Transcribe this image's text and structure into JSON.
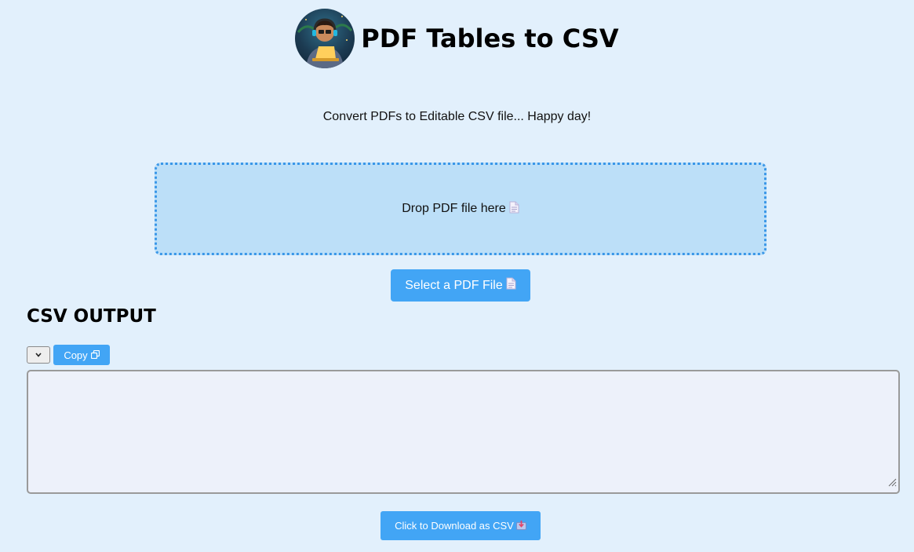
{
  "header": {
    "title": "PDF Tables to CSV",
    "avatar_icon": "coder-avatar-icon"
  },
  "tagline": "Convert PDFs to Editable CSV file... Happy day!",
  "dropzone": {
    "label": "Drop PDF file here",
    "icon": "document-icon"
  },
  "select_button": {
    "label": "Select a PDF File",
    "icon": "document-icon"
  },
  "output": {
    "title": "CSV OUTPUT",
    "select_value": "",
    "copy_label": "Copy",
    "copy_icon": "copy-icon",
    "textarea_value": ""
  },
  "download_button": {
    "label": "Click to Download as CSV",
    "icon": "download-icon"
  },
  "colors": {
    "background": "#e2f0fc",
    "dropzone_bg": "#bcdff8",
    "dropzone_border": "#3a97e8",
    "accent": "#42a5f5",
    "textarea_bg": "#edf1fa"
  }
}
